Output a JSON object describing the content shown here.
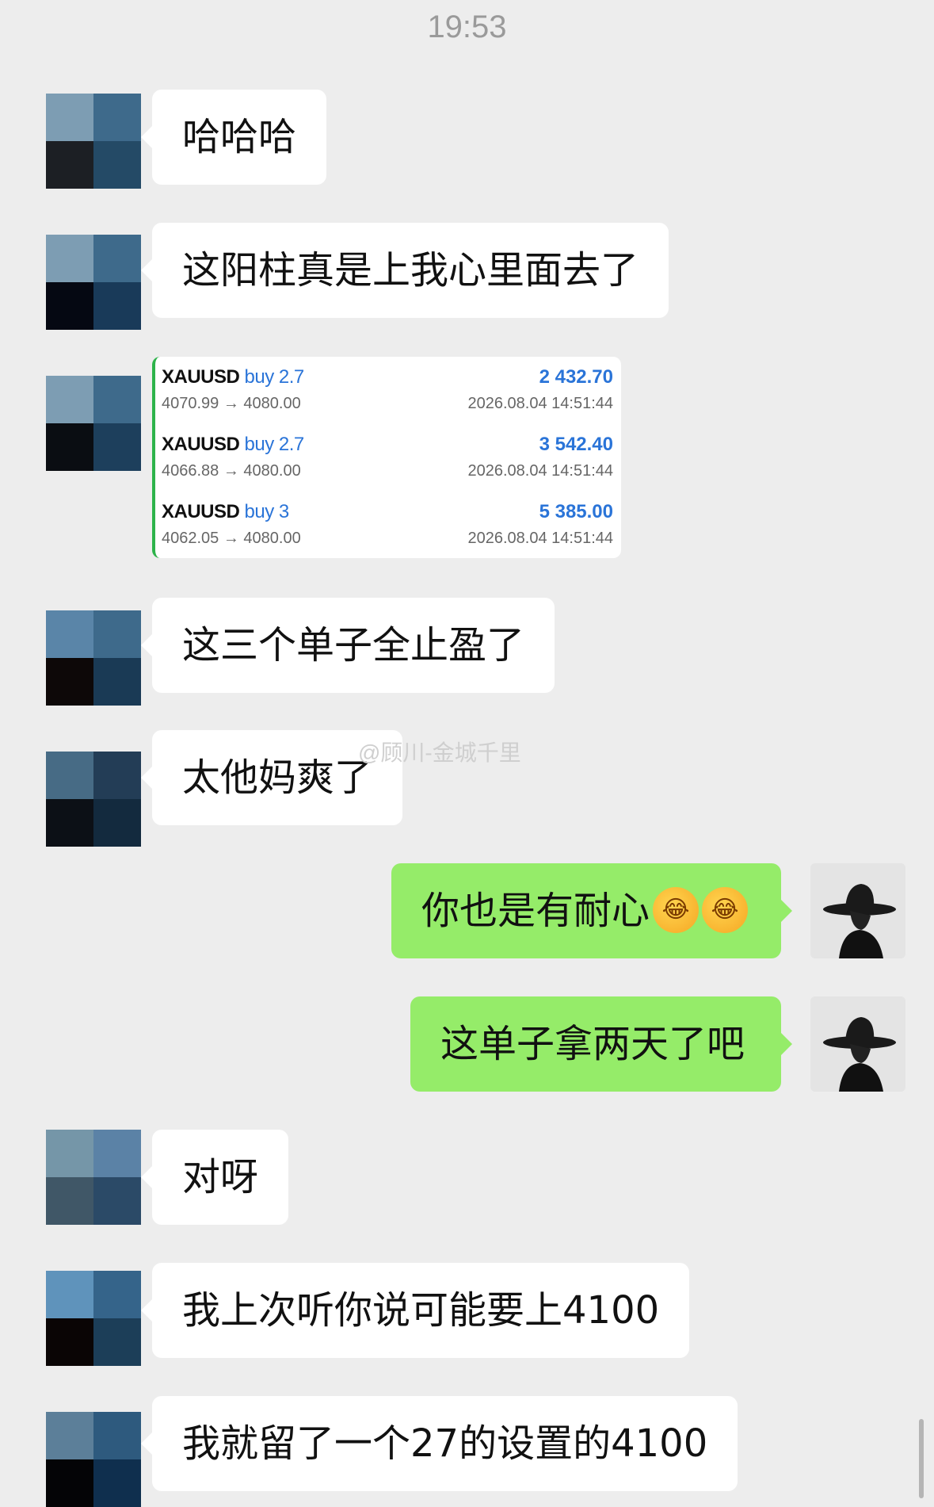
{
  "status_time": "19:53",
  "watermark": "@顾川-金城千里",
  "messages": [
    {
      "text": "哈哈哈"
    },
    {
      "text": "这阳柱真是上我心里面去了"
    },
    {
      "text": "这三个单子全止盈了"
    },
    {
      "text": "太他妈爽了"
    },
    {
      "text": "你也是有耐心"
    },
    {
      "text": "这单子拿两天了吧"
    },
    {
      "text": "对呀"
    },
    {
      "text": "我上次听你说可能要上4100"
    },
    {
      "text": "我就留了一个27的设置的4100"
    }
  ],
  "emoji": [
    "face-palm-laughing-emoji",
    "face-palm-laughing-emoji"
  ],
  "trades": [
    {
      "symbol": "XAUUSD",
      "direction": "buy 2.7",
      "profit": "2 432.70",
      "prices": "4070.99 → 4080.00",
      "date": "2026.08.04 14:51:44"
    },
    {
      "symbol": "XAUUSD",
      "direction": "buy 2.7",
      "profit": "3 542.40",
      "prices": "4066.88 → 4080.00",
      "date": "2026.08.04 14:51:44"
    },
    {
      "symbol": "XAUUSD",
      "direction": "buy 3",
      "profit": "5 385.00",
      "prices": "4062.05 → 4080.00",
      "date": "2026.08.04 14:51:44"
    }
  ],
  "colors": {
    "background": "#ededed",
    "incoming_bubble": "#ffffff",
    "outgoing_bubble": "#95ec69",
    "profit_blue": "#2a74d8",
    "trade_accent": "#2db34a"
  }
}
